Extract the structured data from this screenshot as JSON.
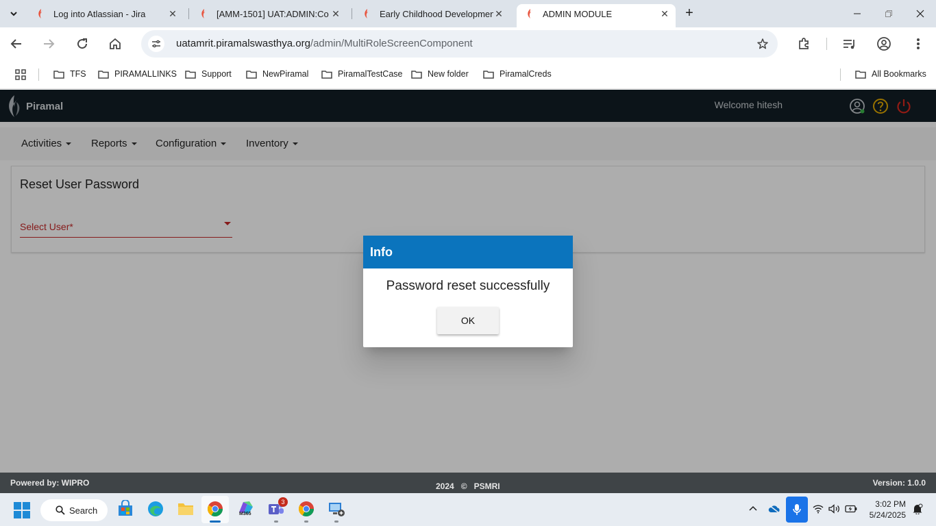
{
  "browser": {
    "tabs": [
      {
        "title": "Log into Atlassian - Jira",
        "active": false
      },
      {
        "title": "[AMM-1501] UAT:ADMIN:Co",
        "active": false
      },
      {
        "title": "Early Childhood Developmen",
        "active": false
      },
      {
        "title": "ADMIN MODULE",
        "active": true
      }
    ],
    "url_host": "uatamrit.piramalswasthya.org",
    "url_path": "/admin/MultiRoleScreenComponent",
    "bookmarks": [
      "TFS",
      "PIRAMALLINKS",
      "Support",
      "NewPiramal",
      "PiramalTestCase",
      "New folder",
      "PiramalCreds"
    ],
    "all_bookmarks_label": "All Bookmarks"
  },
  "app": {
    "logo_text": "Piramal",
    "welcome": "Welcome hitesh",
    "menu": [
      "Activities",
      "Reports",
      "Configuration",
      "Inventory"
    ],
    "card_title": "Reset User Password",
    "select_user_label": "Select User*"
  },
  "dialog": {
    "title": "Info",
    "message": "Password reset successfully",
    "ok_label": "OK"
  },
  "footer": {
    "powered_by": "Powered by: WIPRO",
    "copyright_year": "2024",
    "copyright_symbol": "©",
    "org": "PSMRI",
    "version": "Version: 1.0.0"
  },
  "taskbar": {
    "search_label": "Search",
    "teams_badge": "3",
    "time": "3:02 PM",
    "date": "5/24/2025",
    "m365_label": "M365"
  },
  "colors": {
    "app_header": "#131e26",
    "dialog_header": "#0b74bd",
    "required_red": "#c62828",
    "footer": "#3f4447"
  }
}
